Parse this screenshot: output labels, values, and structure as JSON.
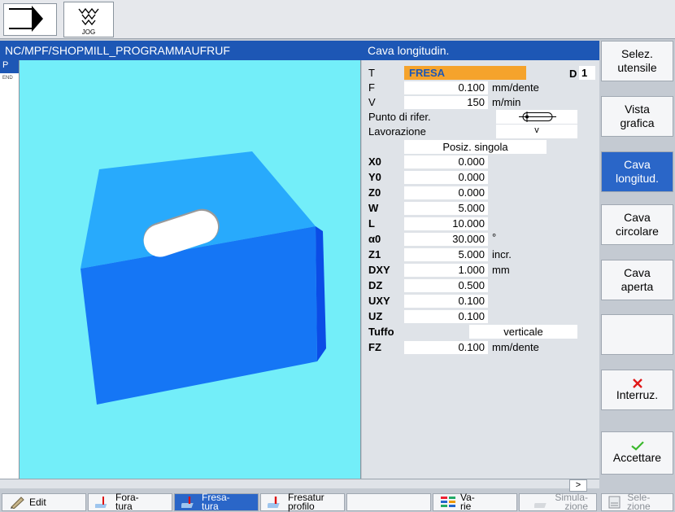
{
  "header": {
    "jog_label": "JOG",
    "path": "NC/MPF/SHOPMILL_PROGRAMMAUFRUF",
    "cycle_title": "Cava longitudin."
  },
  "tree": {
    "current": "P",
    "end_label": "END"
  },
  "params": {
    "tool": {
      "label": "T",
      "value": "FRESA",
      "d_label": "D",
      "d_value": "1"
    },
    "rows_top": [
      {
        "name": "F",
        "value": "0.100",
        "unit": "mm/dente"
      },
      {
        "name": "V",
        "value": "150",
        "unit": "m/min"
      }
    ],
    "ref_point_label": "Punto di rifer.",
    "machining_label": "Lavorazione",
    "machining_value": "v",
    "position_mode": "Posiz. singola",
    "rows": [
      {
        "name": "X0",
        "value": "0.000",
        "unit": ""
      },
      {
        "name": "Y0",
        "value": "0.000",
        "unit": ""
      },
      {
        "name": "Z0",
        "value": "0.000",
        "unit": ""
      },
      {
        "name": "W",
        "value": "5.000",
        "unit": ""
      },
      {
        "name": "L",
        "value": "10.000",
        "unit": ""
      },
      {
        "name": "α0",
        "value": "30.000",
        "unit": "°"
      },
      {
        "name": "Z1",
        "value": "5.000",
        "unit": "incr."
      },
      {
        "name": "DXY",
        "value": "1.000",
        "unit": "mm"
      },
      {
        "name": "DZ",
        "value": "0.500",
        "unit": ""
      },
      {
        "name": "UXY",
        "value": "0.100",
        "unit": ""
      },
      {
        "name": "UZ",
        "value": "0.100",
        "unit": ""
      }
    ],
    "plunge_label": "Tuffo",
    "plunge_value": "verticale",
    "fz": {
      "name": "FZ",
      "value": "0.100",
      "unit": "mm/dente"
    }
  },
  "more_label": ">",
  "vsoftkeys": [
    {
      "line1": "Selez.",
      "line2": "utensile"
    },
    {
      "line1": "Vista",
      "line2": "grafica"
    },
    {
      "line1": "Cava",
      "line2": "longitud."
    },
    {
      "line1": "Cava",
      "line2": "circolare"
    },
    {
      "line1": "Cava",
      "line2": "aperta"
    },
    {
      "line1": "",
      "line2": ""
    },
    {
      "line1": "Interruz.",
      "line2": ""
    },
    {
      "line1": "Accettare",
      "line2": ""
    }
  ],
  "hsoftkeys": [
    {
      "line1": "Edit",
      "line2": ""
    },
    {
      "line1": "Fora-",
      "line2": "tura"
    },
    {
      "line1": "Fresa-",
      "line2": "tura"
    },
    {
      "line1": "Fresatur",
      "line2": "profilo"
    },
    {
      "line1": "",
      "line2": ""
    },
    {
      "line1": "Va-",
      "line2": "rie"
    },
    {
      "line1": "Simula-",
      "line2": "zione"
    },
    {
      "line1": "Sele-",
      "line2": "zione"
    }
  ],
  "colors": {
    "title_bar": "#1d57b5",
    "active_softkey": "#2a66c8",
    "tool_field": "#f5a32c",
    "graphic_bg": "#73eef9",
    "block_top": "#28aafc",
    "block_front": "#1576f5",
    "block_side": "#0b4ce6"
  }
}
